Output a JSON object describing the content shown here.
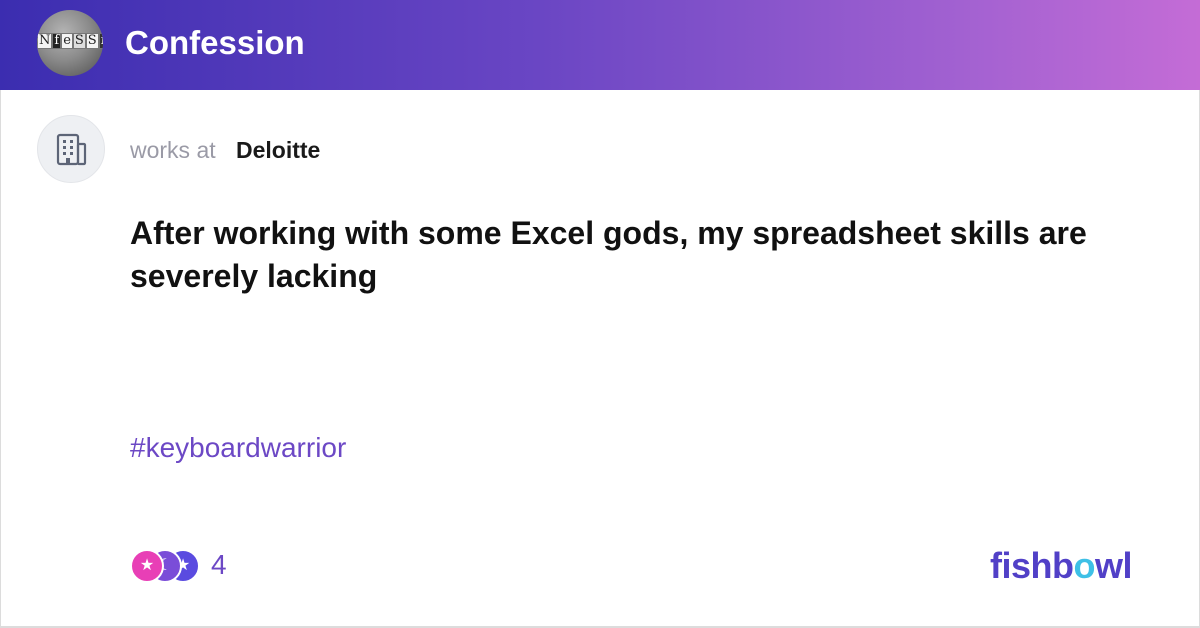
{
  "header": {
    "logo_text": "NfeSSi",
    "title": "Confession"
  },
  "post": {
    "works_at_label": "works at",
    "company": "Deloitte",
    "company_icon": "building-icon",
    "title": "After working with some Excel gods, my spreadsheet skills are severely lacking",
    "hashtag": "#keyboardwarrior"
  },
  "reactions": {
    "icons": [
      "star-reaction-icon",
      "moon-reaction-icon",
      "star-reaction-icon"
    ],
    "count": "4"
  },
  "brand": {
    "name": "fishbowl"
  },
  "colors": {
    "header_start": "#3b2db0",
    "header_end": "#c46cd6",
    "accent": "#6c48c5",
    "brand": "#5140c7",
    "brand_highlight": "#3ec0e6"
  }
}
